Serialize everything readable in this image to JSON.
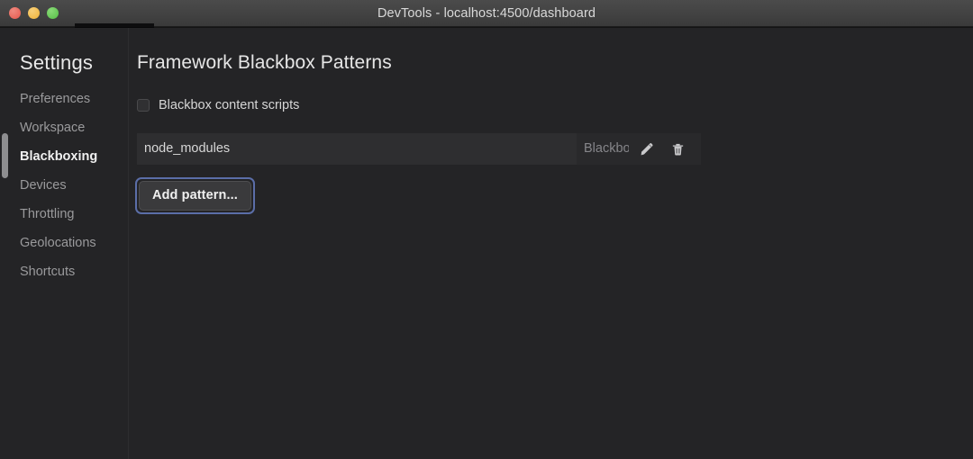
{
  "window": {
    "title": "DevTools - localhost:4500/dashboard",
    "traffic_lights": {
      "close_label": "close",
      "minimize_label": "minimize",
      "maximize_label": "maximize",
      "close_color": "#ec6a5f",
      "minimize_color": "#f4bf50",
      "maximize_color": "#61c555"
    }
  },
  "sidebar": {
    "title": "Settings",
    "items": [
      {
        "label": "Preferences",
        "selected": false
      },
      {
        "label": "Workspace",
        "selected": false
      },
      {
        "label": "Blackboxing",
        "selected": true
      },
      {
        "label": "Devices",
        "selected": false
      },
      {
        "label": "Throttling",
        "selected": false
      },
      {
        "label": "Geolocations",
        "selected": false
      },
      {
        "label": "Shortcuts",
        "selected": false
      }
    ]
  },
  "main": {
    "panel_title": "Framework Blackbox Patterns",
    "checkbox": {
      "label": "Blackbox content scripts",
      "checked": false
    },
    "patterns": [
      {
        "value": "node_modules",
        "placeholder": "Add pattern...",
        "status": "Blackboxed",
        "edit_icon": "pencil-icon",
        "delete_icon": "trash-icon"
      }
    ],
    "add_button": {
      "label": "Add pattern...",
      "focused": true,
      "focus_ring_color": "#5b6ea8"
    }
  },
  "colors": {
    "background": "#242426",
    "titlebar": "#424242",
    "row_background": "#29292b",
    "input_background": "#2e2e30",
    "text_primary": "#e8e8e8",
    "text_secondary": "#9a9a9c",
    "accent": "#5b6ea8"
  }
}
